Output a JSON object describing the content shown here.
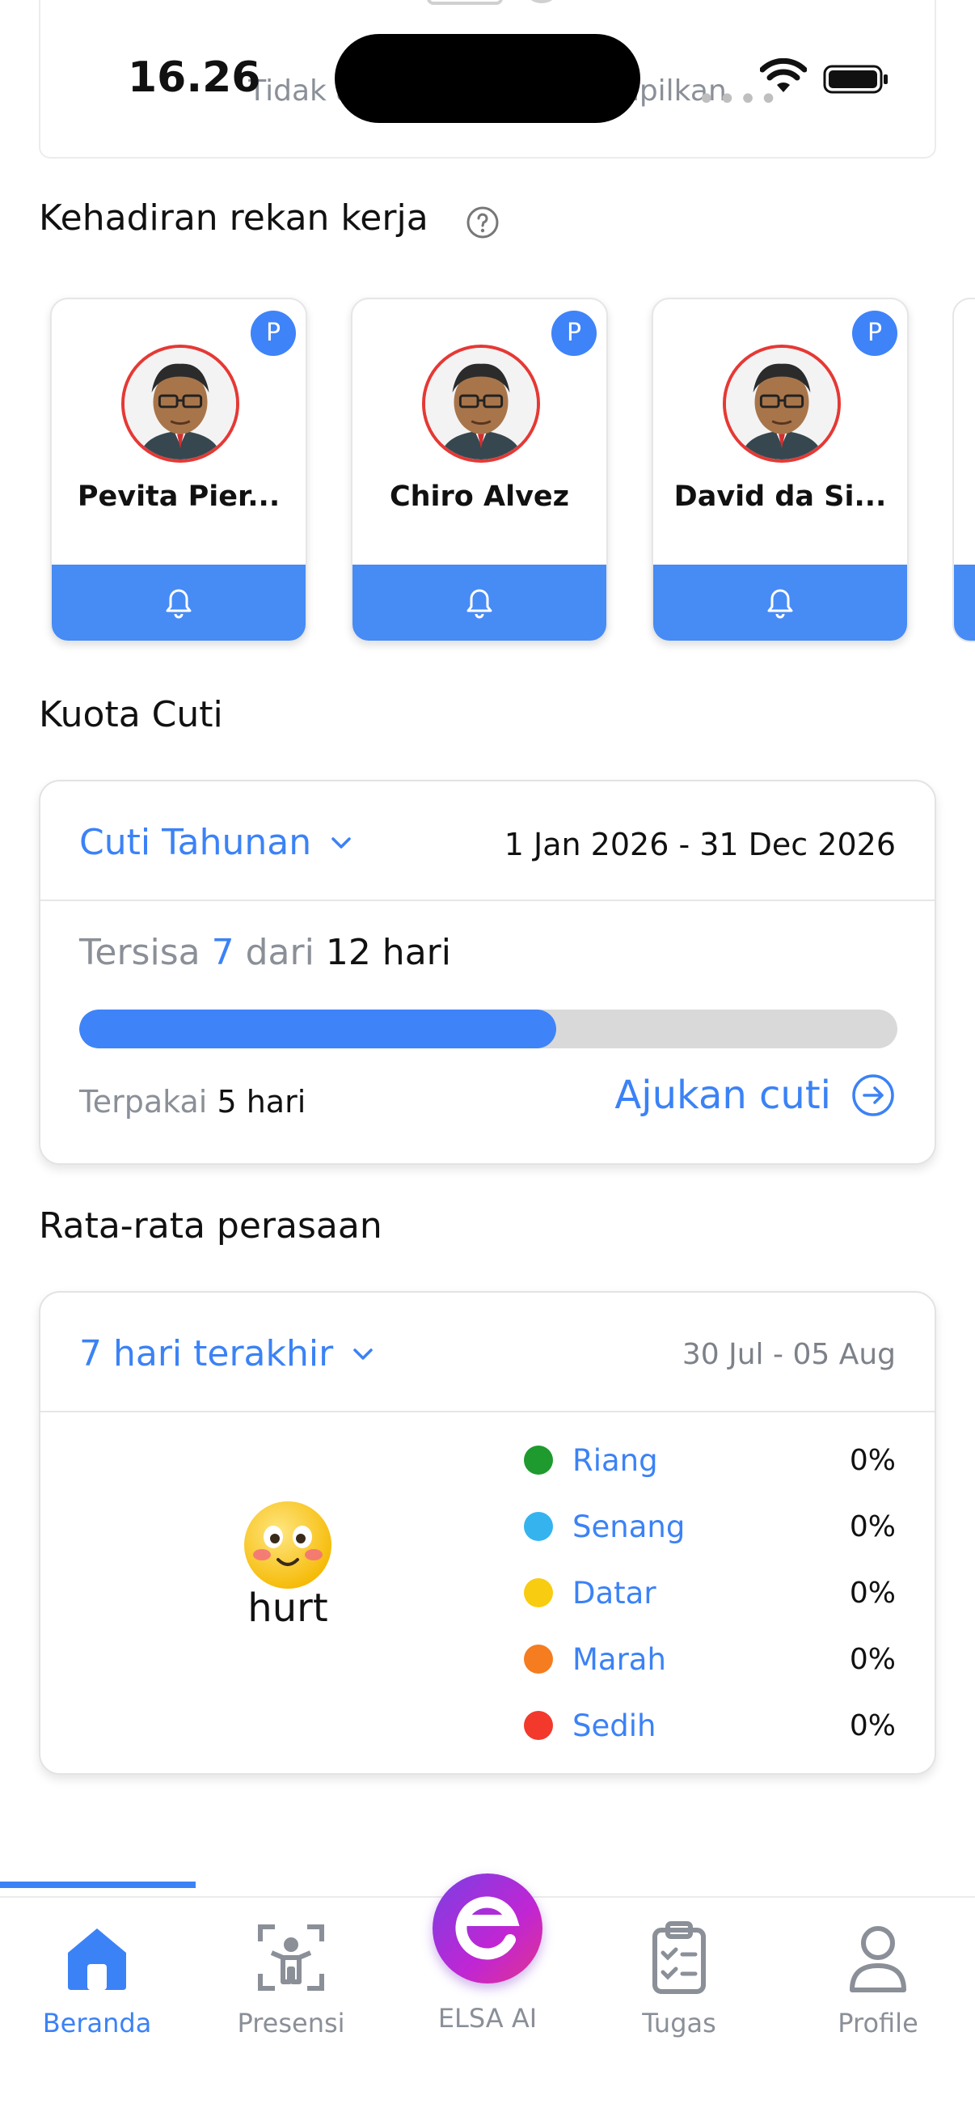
{
  "status_bar": {
    "time": "16.26"
  },
  "top_card": {
    "empty_text": "Tidak ada data yang ditampilkan"
  },
  "coworkers": {
    "title": "Kehadiran rekan kerja",
    "items": [
      {
        "name": "Pevita Pier...",
        "badge": "P"
      },
      {
        "name": "Chiro Alvez",
        "badge": "P"
      },
      {
        "name": "David da Si...",
        "badge": "P"
      }
    ]
  },
  "leave_quota": {
    "title": "Kuota Cuti",
    "type": "Cuti Tahunan",
    "period": "1 Jan 2026 - 31 Dec 2026",
    "remaining_prefix": "Tersisa",
    "remaining": "7",
    "of_word": "dari",
    "total": "12 hari",
    "used_fraction": 0.583,
    "used_label": "Terpakai",
    "used_value": "5 hari",
    "apply_label": "Ajukan cuti"
  },
  "mood": {
    "title": "Rata-rata perasaan",
    "range_select": "7 hari terakhir",
    "date_range": "30 Jul - 05 Aug",
    "current_mood": "hurt",
    "items": [
      {
        "label": "Riang",
        "percent": "0%",
        "color": "#1e9a2e"
      },
      {
        "label": "Senang",
        "percent": "0%",
        "color": "#35b3ef"
      },
      {
        "label": "Datar",
        "percent": "0%",
        "color": "#f8cc10"
      },
      {
        "label": "Marah",
        "percent": "0%",
        "color": "#f57c1f"
      },
      {
        "label": "Sedih",
        "percent": "0%",
        "color": "#f2392c"
      }
    ]
  },
  "nav": {
    "home": "Beranda",
    "attendance": "Presensi",
    "ai": "ELSA AI",
    "tasks": "Tugas",
    "profile": "Profile"
  },
  "colors": {
    "accent": "#3b82f6",
    "card_footer": "#478bf5",
    "elsa_gradient": [
      "#7b3fe4",
      "#e0338f"
    ]
  }
}
